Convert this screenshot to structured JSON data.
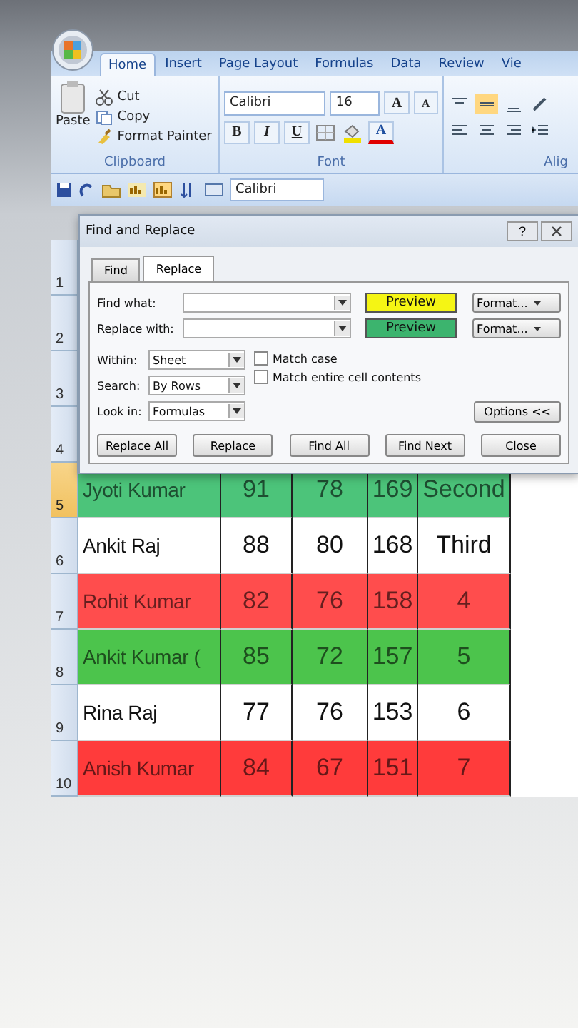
{
  "ribbon": {
    "tabs": [
      {
        "label": "Home",
        "selected": true
      },
      {
        "label": "Insert",
        "selected": false
      },
      {
        "label": "Page Layout",
        "selected": false
      },
      {
        "label": "Formulas",
        "selected": false
      },
      {
        "label": "Data",
        "selected": false
      },
      {
        "label": "Review",
        "selected": false
      },
      {
        "label": "Vie",
        "selected": false
      }
    ],
    "clipboard": {
      "paste": "Paste",
      "cut": "Cut",
      "copy": "Copy",
      "format_painter": "Format Painter",
      "label": "Clipboard"
    },
    "font": {
      "name": "Calibri",
      "size": "16",
      "grow": "A",
      "shrink": "A",
      "bold": "B",
      "italic": "I",
      "underline": "U",
      "font_color": "A",
      "label": "Font"
    },
    "alignment": {
      "label": "Alig"
    }
  },
  "quick_access": {
    "font": "Calibri"
  },
  "sheet": {
    "rows": [
      {
        "number": "1",
        "selected": false
      },
      {
        "number": "2",
        "selected": false
      },
      {
        "number": "3",
        "selected": false
      },
      {
        "number": "4",
        "selected": false
      },
      {
        "number": "5",
        "selected": true,
        "color": "#4cc47a",
        "cells": [
          "Jyoti Kumar",
          "91",
          "78",
          "169",
          "Second"
        ]
      },
      {
        "number": "6",
        "selected": false,
        "color": "#ffffff",
        "cells": [
          "Ankit Raj",
          "88",
          "80",
          "168",
          "Third"
        ]
      },
      {
        "number": "7",
        "selected": false,
        "color": "#ff4d4d",
        "cells": [
          "Rohit Kumar",
          "82",
          "76",
          "158",
          "4"
        ]
      },
      {
        "number": "8",
        "selected": false,
        "color": "#4cc44c",
        "cells": [
          "Ankit Kumar (",
          "85",
          "72",
          "157",
          "5"
        ]
      },
      {
        "number": "9",
        "selected": false,
        "color": "#ffffff",
        "cells": [
          "Rina Raj",
          "77",
          "76",
          "153",
          "6"
        ]
      },
      {
        "number": "10",
        "selected": false,
        "color": "#ff3b3b",
        "cells": [
          "Anish Kumar",
          "84",
          "67",
          "151",
          "7"
        ]
      }
    ]
  },
  "dialog": {
    "title": "Find and Replace",
    "help": "?",
    "tabs": [
      {
        "label": "Find",
        "selected": false
      },
      {
        "label": "Replace",
        "selected": true
      }
    ],
    "fields": [
      {
        "label": "Find what:",
        "preview": "Preview",
        "color": "#f5f514",
        "format": "Format..."
      },
      {
        "label": "Replace with:",
        "preview": "Preview",
        "color": "#3cb46e",
        "format": "Format..."
      }
    ],
    "scope": [
      {
        "label": "Within:",
        "value": "Sheet"
      },
      {
        "label": "Search:",
        "value": "By Rows"
      },
      {
        "label": "Look in:",
        "value": "Formulas"
      }
    ],
    "checkboxes": [
      {
        "label": "Match case",
        "checked": false
      },
      {
        "label": "Match entire cell contents",
        "checked": false
      }
    ],
    "options": "Options <<",
    "buttons": [
      "Replace All",
      "Replace",
      "Find All",
      "Find Next",
      "Close"
    ]
  }
}
